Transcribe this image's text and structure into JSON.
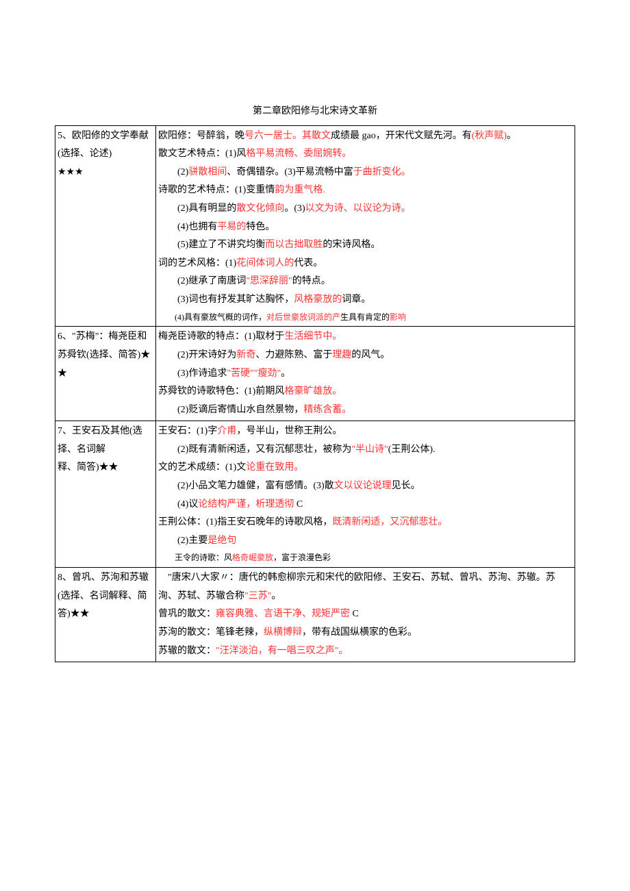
{
  "title": "第二章欧阳修与北宋诗文革新",
  "rows": [
    {
      "left": [
        {
          "segs": [
            {
              "t": "5、欧阳修的文学奉献(选择、论述)"
            }
          ]
        },
        {
          "segs": [
            {
              "t": "★★★"
            }
          ]
        }
      ],
      "right": [
        {
          "type": "line",
          "segs": [
            {
              "t": "欧阳修：号醉翁，晚"
            },
            {
              "t": "号六一居士。其散文",
              "red": true
            },
            {
              "t": "成绩最 gao，开宋代文赋先河。有"
            },
            {
              "t": "(秋声赋)",
              "red": true
            },
            {
              "t": "。"
            }
          ]
        },
        {
          "type": "line",
          "segs": [
            {
              "t": "散文艺术特点："
            },
            {
              "t": "(1)"
            },
            {
              "t": "风"
            },
            {
              "t": "格平易流畅、委屈婉转。",
              "red": true
            }
          ]
        },
        {
          "type": "indent",
          "segs": [
            {
              "t": "(2)"
            },
            {
              "t": "骈散相间",
              "red": true
            },
            {
              "t": "、奇偶错杂。"
            },
            {
              "t": "(3)"
            },
            {
              "t": "平易流畅中富"
            },
            {
              "t": "于曲折变化。",
              "red": true
            }
          ]
        },
        {
          "type": "line",
          "segs": [
            {
              "t": "诗歌的艺术特点："
            },
            {
              "t": "(1)"
            },
            {
              "t": "变重情"
            },
            {
              "t": "韵为重气格.",
              "red": true
            }
          ]
        },
        {
          "type": "indent",
          "segs": [
            {
              "t": "(2)"
            },
            {
              "t": "具有明显的"
            },
            {
              "t": "散文化倾向",
              "red": true
            },
            {
              "t": "。"
            },
            {
              "t": "(3)"
            },
            {
              "t": "以文为诗、以议论为诗。",
              "red": true
            }
          ]
        },
        {
          "type": "indent",
          "segs": [
            {
              "t": "(4)"
            },
            {
              "t": "也拥有"
            },
            {
              "t": "平易的",
              "red": true
            },
            {
              "t": "特色。"
            }
          ]
        },
        {
          "type": "indent",
          "segs": [
            {
              "t": "(5)"
            },
            {
              "t": "建立了不讲究均衡"
            },
            {
              "t": "而以古拙取胜",
              "red": true
            },
            {
              "t": "的宋诗风格。"
            }
          ]
        },
        {
          "type": "line",
          "segs": [
            {
              "t": "词的艺术风格："
            },
            {
              "t": "(1)"
            },
            {
              "t": "花间体词人的",
              "red": true
            },
            {
              "t": "代表。"
            }
          ]
        },
        {
          "type": "indent",
          "segs": [
            {
              "t": "(2)"
            },
            {
              "t": "继承了南唐词"
            },
            {
              "t": "\"思深辞丽\"",
              "red": true
            },
            {
              "t": "的特点。"
            }
          ]
        },
        {
          "type": "indent",
          "segs": [
            {
              "t": "(3)"
            },
            {
              "t": "词也有抒发其旷达胸怀，"
            },
            {
              "t": "风格豪放的",
              "red": true
            },
            {
              "t": "词章。"
            }
          ]
        },
        {
          "type": "trunc",
          "segs": [
            {
              "t": "(4)具有豪放气概的词作，"
            },
            {
              "t": "对后世豪放词派的产",
              "red": true
            },
            {
              "t": "生具有肯定的"
            },
            {
              "t": "影响",
              "red": true
            }
          ]
        }
      ]
    },
    {
      "left": [
        {
          "segs": [
            {
              "t": "6、\"苏梅\"：梅尧臣和苏舜钦(选择、简答)★★"
            }
          ]
        }
      ],
      "right": [
        {
          "type": "line",
          "segs": [
            {
              "t": "梅尧臣诗歌的特点："
            },
            {
              "t": "(1)"
            },
            {
              "t": "取材于"
            },
            {
              "t": "生活细节中。",
              "red": true
            }
          ]
        },
        {
          "type": "indent",
          "segs": [
            {
              "t": "(2)"
            },
            {
              "t": "开宋诗好为"
            },
            {
              "t": "新奇",
              "red": true
            },
            {
              "t": "、力避陈熟、富于"
            },
            {
              "t": "理趣",
              "red": true
            },
            {
              "t": "的风气。"
            }
          ]
        },
        {
          "type": "indent",
          "segs": [
            {
              "t": "(3)"
            },
            {
              "t": "作诗追求"
            },
            {
              "t": "\"苦硬\"\"瘦劲\"",
              "red": true
            },
            {
              "t": "。"
            }
          ]
        },
        {
          "type": "line",
          "segs": [
            {
              "t": "苏舜钦的诗歌特色："
            },
            {
              "t": "(1)"
            },
            {
              "t": "前期风"
            },
            {
              "t": "格豪旷雄放。",
              "red": true
            }
          ]
        },
        {
          "type": "indent",
          "segs": [
            {
              "t": "(2)"
            },
            {
              "t": "贬谪后寄情山水自然景物，"
            },
            {
              "t": "精练含蓄。",
              "red": true
            }
          ]
        }
      ]
    },
    {
      "left": [
        {
          "segs": [
            {
              "t": "7、王安石及其他(选择、名词解"
            }
          ]
        },
        {
          "segs": [
            {
              "t": "释、简答)★★"
            }
          ]
        }
      ],
      "right": [
        {
          "type": "line",
          "segs": [
            {
              "t": "王安石："
            },
            {
              "t": "(1)"
            },
            {
              "t": "字"
            },
            {
              "t": "介甫",
              "red": true
            },
            {
              "t": "，号半山，世称王荆公。"
            }
          ]
        },
        {
          "type": "indent",
          "segs": [
            {
              "t": "(2)"
            },
            {
              "t": "既有清新闲适，又有沉郁悲壮，被称为"
            },
            {
              "t": "\"半山诗\"",
              "red": true
            },
            {
              "t": "(王荆公体)."
            }
          ]
        },
        {
          "type": "line",
          "segs": [
            {
              "t": "文的艺术成绩："
            },
            {
              "t": "(1)"
            },
            {
              "t": "文"
            },
            {
              "t": "论重在致用。",
              "red": true
            }
          ]
        },
        {
          "type": "indent",
          "segs": [
            {
              "t": "(2)"
            },
            {
              "t": "小品文笔力雄健，富有感情。"
            },
            {
              "t": "(3)"
            },
            {
              "t": "散"
            },
            {
              "t": "文以议论说理",
              "red": true
            },
            {
              "t": "见长。"
            }
          ]
        },
        {
          "type": "indent",
          "segs": [
            {
              "t": "(4)"
            },
            {
              "t": "议"
            },
            {
              "t": "论结构严谨，析理透彻",
              "red": true
            },
            {
              "t": " C"
            }
          ]
        },
        {
          "type": "line",
          "segs": [
            {
              "t": "王荆公体："
            },
            {
              "t": "(1)"
            },
            {
              "t": "指王安石晚年的诗歌风格，"
            },
            {
              "t": "既清新闲适，又沉郁悲壮。",
              "red": true
            }
          ]
        },
        {
          "type": "indent",
          "segs": [
            {
              "t": "(2)"
            },
            {
              "t": "主要"
            },
            {
              "t": "是绝句",
              "red": true
            }
          ]
        },
        {
          "type": "trunc",
          "segs": [
            {
              "t": "王令的诗歌：风"
            },
            {
              "t": "格奇崛豪放",
              "red": true
            },
            {
              "t": "，富于浪漫色彩"
            }
          ]
        }
      ]
    },
    {
      "left": [
        {
          "segs": [
            {
              "t": "8、曾巩、苏洵和苏辙(选择、名词解释、简答)★★"
            }
          ]
        }
      ],
      "right": [
        {
          "type": "line",
          "segs": [
            {
              "t": "　\"唐宋八大家〃：唐代的韩愈柳宗元和宋代的欧阳修、王安石、苏轼、曾巩、苏洵、苏辙。苏洵、苏轼、苏辙合称"
            },
            {
              "t": "\"三苏\"",
              "red": true
            },
            {
              "t": "。"
            }
          ]
        },
        {
          "type": "line",
          "segs": [
            {
              "t": "曾巩的散文："
            },
            {
              "t": "雍容典雅、言语干净、规矩严密",
              "red": true
            },
            {
              "t": " C"
            }
          ]
        },
        {
          "type": "line",
          "segs": [
            {
              "t": "苏洵的散文：笔锋老辣，"
            },
            {
              "t": "纵横博辩",
              "red": true
            },
            {
              "t": "，带有战国纵横家的色彩。"
            }
          ]
        },
        {
          "type": "line",
          "segs": [
            {
              "t": "苏辙的散文："
            },
            {
              "t": "\"汪洋淡泊，有一唱三叹之声\"。",
              "red": true
            }
          ]
        }
      ]
    }
  ]
}
